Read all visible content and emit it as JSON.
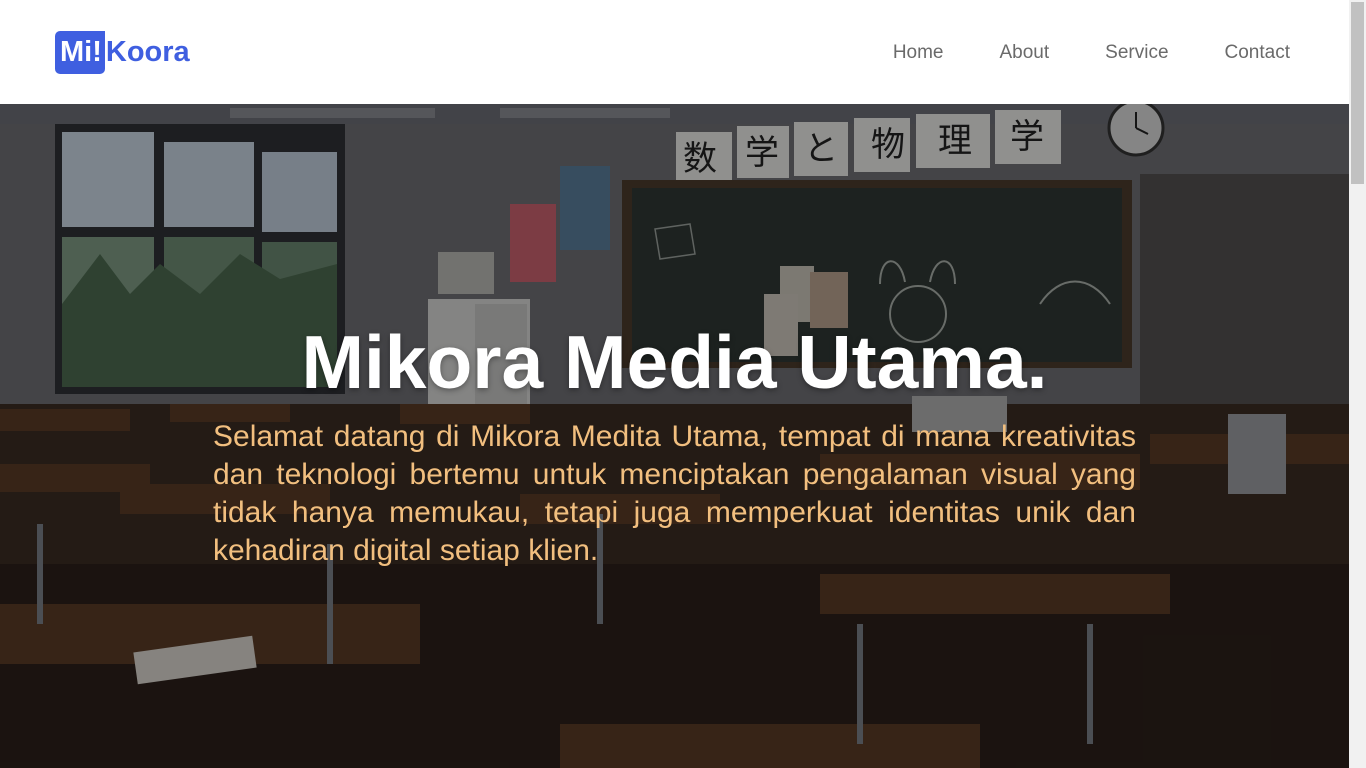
{
  "navbar": {
    "logo_mark": "Mi!",
    "logo_text": "Koora",
    "links": [
      "Home",
      "About",
      "Service",
      "Contact"
    ]
  },
  "hero": {
    "title": "Mikora Media Utama.",
    "description": "Selamat datang di Mikora Medita Utama, tempat di mana kreativitas dan teknologi bertemu untuk menciptakan pengalaman visual yang tidak hanya memukau, tetapi juga memperkuat identitas unik dan kehadiran digital setiap klien.",
    "background_kanji": [
      "数",
      "学",
      "と",
      "物",
      "理",
      "学"
    ]
  },
  "colors": {
    "brand": "#3f5fe0",
    "nav_text": "#6a6a6a",
    "hero_title": "#ffffff",
    "hero_desc": "#f2bf7f"
  }
}
